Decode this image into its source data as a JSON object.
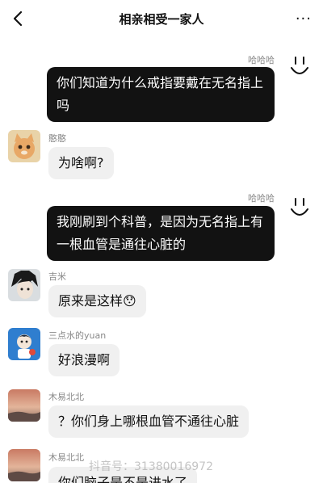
{
  "header": {
    "title": "相亲相受一家人",
    "more_glyph": "···"
  },
  "messages": [
    {
      "side": "right",
      "name": "哈哈哈",
      "text": "你们知道为什么戒指要戴在无名指上吗"
    },
    {
      "side": "left",
      "name": "憨憨",
      "text": "为啥啊?"
    },
    {
      "side": "right",
      "name": "哈哈哈",
      "text": "我刚刷到个科普，是因为无名指上有一根血管是通往心脏的"
    },
    {
      "side": "left",
      "name": "吉米",
      "text": "原来是这样😯"
    },
    {
      "side": "left",
      "name": "三点水的yuan",
      "text": "好浪漫啊"
    },
    {
      "side": "left",
      "name": "木易北北",
      "text": "？你们身上哪根血管不通往心脏"
    },
    {
      "side": "left",
      "name": "木易北北",
      "text": "你们脑子是不是进水了"
    }
  ],
  "watermark": "抖音号：31380016972",
  "colors": {
    "self_bubble": "#121212",
    "other_bubble": "#f0f0f0",
    "name_text": "#888888"
  }
}
